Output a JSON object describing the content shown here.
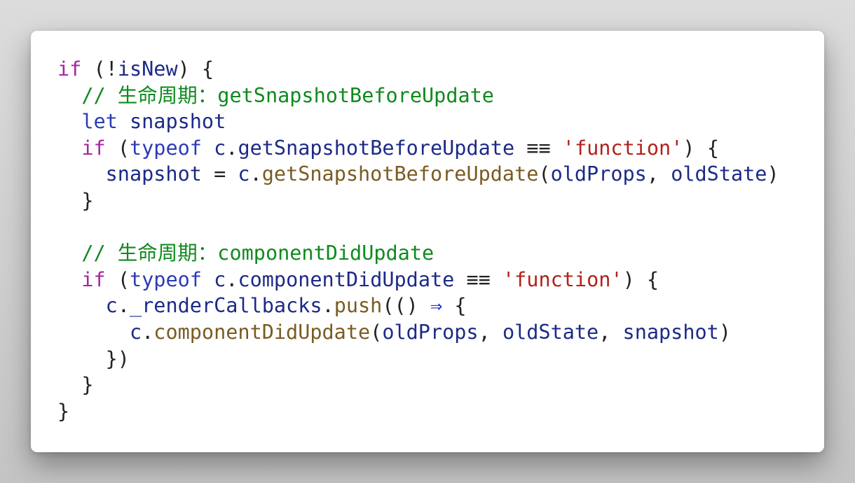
{
  "code": {
    "lines": [
      {
        "tokens": [
          {
            "t": "if",
            "c": "kw"
          },
          {
            "t": " (!",
            "c": "pn"
          },
          {
            "t": "isNew",
            "c": "id"
          },
          {
            "t": ") {",
            "c": "pn"
          }
        ]
      },
      {
        "tokens": [
          {
            "t": "  ",
            "c": "pn"
          },
          {
            "t": "// 生命周期：getSnapshotBeforeUpdate",
            "c": "cm"
          }
        ]
      },
      {
        "tokens": [
          {
            "t": "  ",
            "c": "pn"
          },
          {
            "t": "let",
            "c": "kw2"
          },
          {
            "t": " ",
            "c": "pn"
          },
          {
            "t": "snapshot",
            "c": "id"
          }
        ]
      },
      {
        "tokens": [
          {
            "t": "  ",
            "c": "pn"
          },
          {
            "t": "if",
            "c": "kw"
          },
          {
            "t": " (",
            "c": "pn"
          },
          {
            "t": "typeof",
            "c": "kw2"
          },
          {
            "t": " ",
            "c": "pn"
          },
          {
            "t": "c",
            "c": "id"
          },
          {
            "t": ".",
            "c": "pn"
          },
          {
            "t": "getSnapshotBeforeUpdate",
            "c": "id"
          },
          {
            "t": " ",
            "c": "pn"
          },
          {
            "t": "≡≡",
            "c": "pn"
          },
          {
            "t": " ",
            "c": "pn"
          },
          {
            "t": "'function'",
            "c": "str"
          },
          {
            "t": ") {",
            "c": "pn"
          }
        ]
      },
      {
        "tokens": [
          {
            "t": "    ",
            "c": "pn"
          },
          {
            "t": "snapshot",
            "c": "id"
          },
          {
            "t": " = ",
            "c": "pn"
          },
          {
            "t": "c",
            "c": "id"
          },
          {
            "t": ".",
            "c": "pn"
          },
          {
            "t": "getSnapshotBeforeUpdate",
            "c": "fn"
          },
          {
            "t": "(",
            "c": "pn"
          },
          {
            "t": "oldProps",
            "c": "id"
          },
          {
            "t": ", ",
            "c": "pn"
          },
          {
            "t": "oldState",
            "c": "id"
          },
          {
            "t": ")",
            "c": "pn"
          }
        ]
      },
      {
        "tokens": [
          {
            "t": "  }",
            "c": "pn"
          }
        ]
      },
      {
        "tokens": [
          {
            "t": "",
            "c": "pn"
          }
        ]
      },
      {
        "tokens": [
          {
            "t": "  ",
            "c": "pn"
          },
          {
            "t": "// 生命周期：componentDidUpdate",
            "c": "cm"
          }
        ]
      },
      {
        "tokens": [
          {
            "t": "  ",
            "c": "pn"
          },
          {
            "t": "if",
            "c": "kw"
          },
          {
            "t": " (",
            "c": "pn"
          },
          {
            "t": "typeof",
            "c": "kw2"
          },
          {
            "t": " ",
            "c": "pn"
          },
          {
            "t": "c",
            "c": "id"
          },
          {
            "t": ".",
            "c": "pn"
          },
          {
            "t": "componentDidUpdate",
            "c": "id"
          },
          {
            "t": " ",
            "c": "pn"
          },
          {
            "t": "≡≡",
            "c": "pn"
          },
          {
            "t": " ",
            "c": "pn"
          },
          {
            "t": "'function'",
            "c": "str"
          },
          {
            "t": ") {",
            "c": "pn"
          }
        ]
      },
      {
        "tokens": [
          {
            "t": "    ",
            "c": "pn"
          },
          {
            "t": "c",
            "c": "id"
          },
          {
            "t": ".",
            "c": "pn"
          },
          {
            "t": "_renderCallbacks",
            "c": "id"
          },
          {
            "t": ".",
            "c": "pn"
          },
          {
            "t": "push",
            "c": "fn"
          },
          {
            "t": "(() ",
            "c": "pn"
          },
          {
            "t": "⇒",
            "c": "op"
          },
          {
            "t": " {",
            "c": "pn"
          }
        ]
      },
      {
        "tokens": [
          {
            "t": "      ",
            "c": "pn"
          },
          {
            "t": "c",
            "c": "id"
          },
          {
            "t": ".",
            "c": "pn"
          },
          {
            "t": "componentDidUpdate",
            "c": "fn"
          },
          {
            "t": "(",
            "c": "pn"
          },
          {
            "t": "oldProps",
            "c": "id"
          },
          {
            "t": ", ",
            "c": "pn"
          },
          {
            "t": "oldState",
            "c": "id"
          },
          {
            "t": ", ",
            "c": "pn"
          },
          {
            "t": "snapshot",
            "c": "id"
          },
          {
            "t": ")",
            "c": "pn"
          }
        ]
      },
      {
        "tokens": [
          {
            "t": "    })",
            "c": "pn"
          }
        ]
      },
      {
        "tokens": [
          {
            "t": "  }",
            "c": "pn"
          }
        ]
      },
      {
        "tokens": [
          {
            "t": "}",
            "c": "pn"
          }
        ]
      }
    ]
  },
  "colors": {
    "background": "#c9c9c9",
    "card": "#ffffff",
    "keyword": "#a626a4",
    "keyword2": "#2a3cb5",
    "comment": "#0f8a1e",
    "string": "#b0221b",
    "function": "#7a5b22",
    "identifier": "#1c2a87",
    "operator": "#1f2bd6"
  }
}
